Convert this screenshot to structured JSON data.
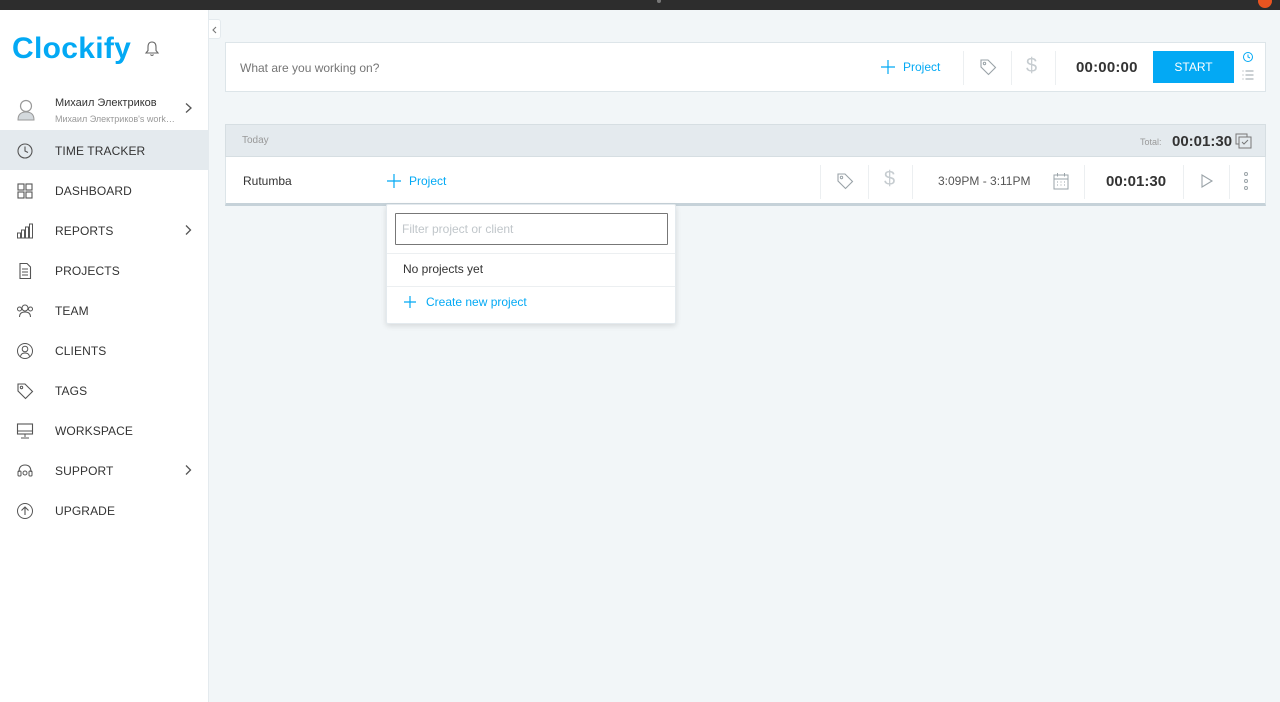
{
  "app": {
    "logo": "Clockify"
  },
  "user": {
    "name": "Михаил Электриков",
    "workspace": "Михаил Электриков's workspace"
  },
  "nav": [
    {
      "label": "TIME TRACKER",
      "icon": "clock-icon",
      "active": true,
      "chevron": false
    },
    {
      "label": "DASHBOARD",
      "icon": "dashboard-icon",
      "active": false,
      "chevron": false
    },
    {
      "label": "REPORTS",
      "icon": "reports-icon",
      "active": false,
      "chevron": true
    },
    {
      "label": "PROJECTS",
      "icon": "projects-icon",
      "active": false,
      "chevron": false
    },
    {
      "label": "TEAM",
      "icon": "team-icon",
      "active": false,
      "chevron": false
    },
    {
      "label": "CLIENTS",
      "icon": "clients-icon",
      "active": false,
      "chevron": false
    },
    {
      "label": "TAGS",
      "icon": "tag-icon",
      "active": false,
      "chevron": false
    },
    {
      "label": "WORKSPACE",
      "icon": "workspace-icon",
      "active": false,
      "chevron": false
    },
    {
      "label": "SUPPORT",
      "icon": "support-icon",
      "active": false,
      "chevron": true
    },
    {
      "label": "UPGRADE",
      "icon": "upgrade-icon",
      "active": false,
      "chevron": false
    }
  ],
  "timer": {
    "placeholder": "What are you working on?",
    "project_label": "Project",
    "dollar": "$",
    "time": "00:00:00",
    "start_label": "START"
  },
  "day": {
    "label": "Today",
    "total_label": "Total:",
    "total": "00:01:30"
  },
  "entry": {
    "description": "Rutumba",
    "project_label": "Project",
    "dollar": "$",
    "range": "3:09PM - 3:11PM",
    "duration": "00:01:30"
  },
  "dropdown": {
    "placeholder": "Filter project or client",
    "empty_text": "No projects yet",
    "create_label": "Create new project"
  },
  "colors": {
    "accent": "#03a9f4",
    "active_bg": "#e4eaee",
    "page_bg": "#f2f6f8"
  }
}
